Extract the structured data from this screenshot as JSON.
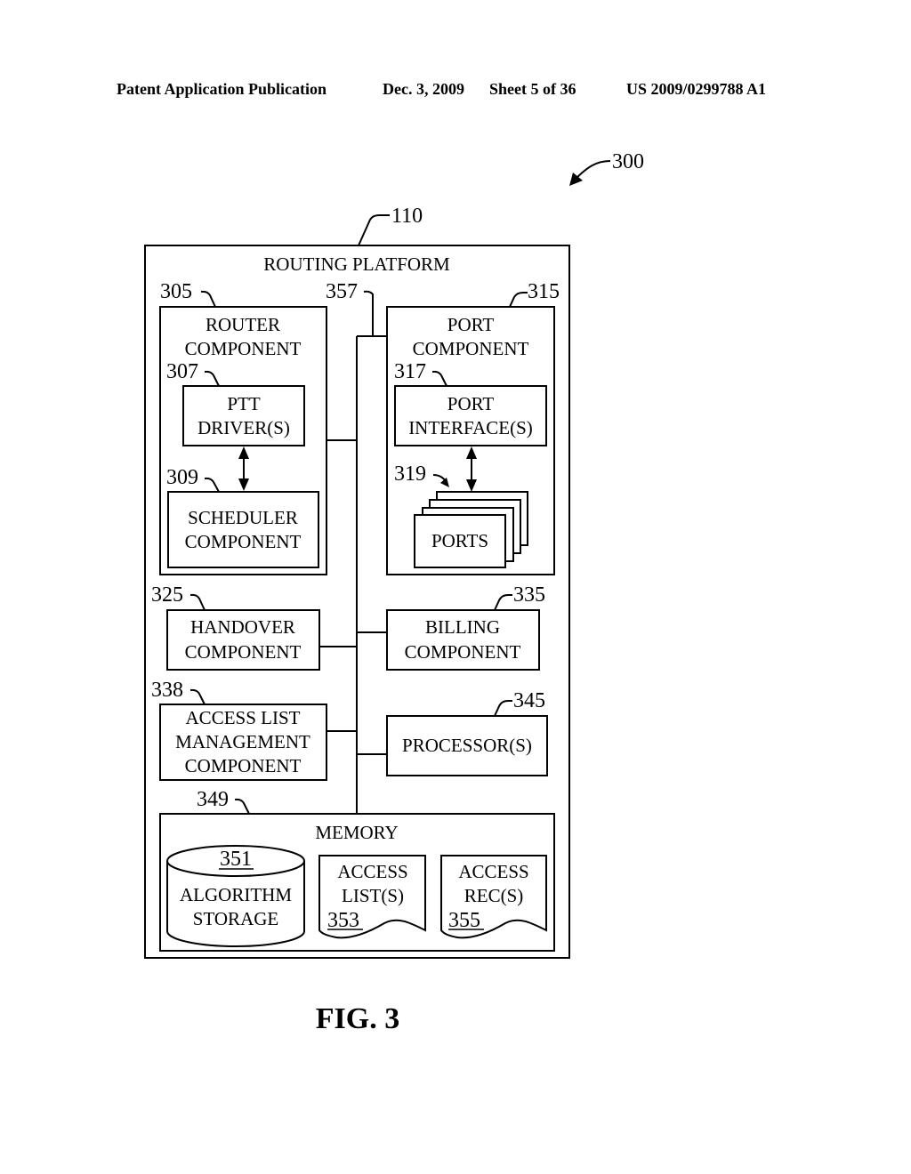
{
  "header": {
    "publication": "Patent Application Publication",
    "date": "Dec. 3, 2009",
    "sheet": "Sheet 5 of 36",
    "pub_number": "US 2009/0299788 A1"
  },
  "figure": {
    "ref": "300",
    "caption": "FIG. 3"
  },
  "platform": {
    "ref": "110",
    "title": "ROUTING PLATFORM",
    "bus_ref": "357"
  },
  "router": {
    "ref": "305",
    "line1": "ROUTER",
    "line2": "COMPONENT",
    "ptt": {
      "ref": "307",
      "line1": "PTT",
      "line2": "DRIVER(S)"
    },
    "scheduler": {
      "ref": "309",
      "line1": "SCHEDULER",
      "line2": "COMPONENT"
    }
  },
  "port": {
    "ref": "315",
    "line1": "PORT",
    "line2": "COMPONENT",
    "interface": {
      "ref": "317",
      "line1": "PORT",
      "line2": "INTERFACE(S)"
    },
    "ports": {
      "ref": "319",
      "label": "PORTS"
    }
  },
  "handover": {
    "ref": "325",
    "line1": "HANDOVER",
    "line2": "COMPONENT"
  },
  "billing": {
    "ref": "335",
    "line1": "BILLING",
    "line2": "COMPONENT"
  },
  "access_mgmt": {
    "ref": "338",
    "line1": "ACCESS LIST",
    "line2": "MANAGEMENT",
    "line3": "COMPONENT"
  },
  "processor": {
    "ref": "345",
    "label": "PROCESSOR(S)"
  },
  "memory": {
    "ref": "349",
    "title": "MEMORY",
    "algorithm": {
      "ref": "351",
      "line1": "ALGORITHM",
      "line2": "STORAGE"
    },
    "access_lists": {
      "ref": "353",
      "line1": "ACCESS",
      "line2": "LIST(S)"
    },
    "access_recs": {
      "ref": "355",
      "line1": "ACCESS",
      "line2": "REC(S)"
    }
  }
}
